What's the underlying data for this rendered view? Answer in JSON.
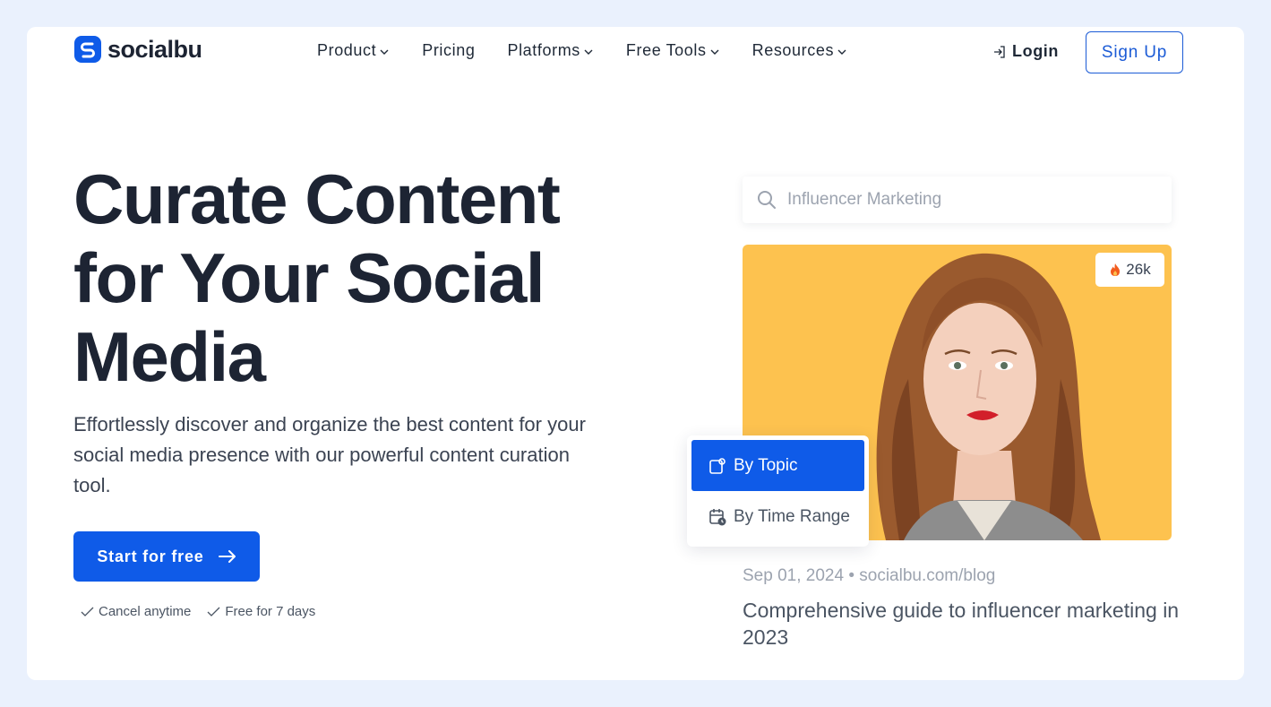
{
  "brand": {
    "name": "socialbu",
    "color": "#0f5be8"
  },
  "nav": {
    "items": [
      {
        "label": "Product",
        "has_dropdown": true
      },
      {
        "label": "Pricing",
        "has_dropdown": false
      },
      {
        "label": "Platforms",
        "has_dropdown": true
      },
      {
        "label": "Free Tools",
        "has_dropdown": true
      },
      {
        "label": "Resources",
        "has_dropdown": true
      }
    ],
    "login_label": "Login",
    "signup_label": "Sign Up"
  },
  "hero": {
    "title": "Curate Content for Your Social Media",
    "description": "Effortlessly discover and organize the best content for your social media presence with our powerful content curation tool.",
    "cta_label": "Start for free",
    "perks": [
      "Cancel anytime",
      "Free for 7 days"
    ]
  },
  "showcase": {
    "search_placeholder": "Influencer Marketing",
    "engagement_count": "26k",
    "filters": [
      {
        "label": "By Topic",
        "active": true,
        "icon": "topic-icon"
      },
      {
        "label": "By Time Range",
        "active": false,
        "icon": "calendar-clock-icon"
      }
    ],
    "article_meta": "Sep 01, 2024 • socialbu.com/blog",
    "article_title": "Comprehensive guide to influencer marketing in 2023",
    "image_bg": "#fdc24f"
  }
}
